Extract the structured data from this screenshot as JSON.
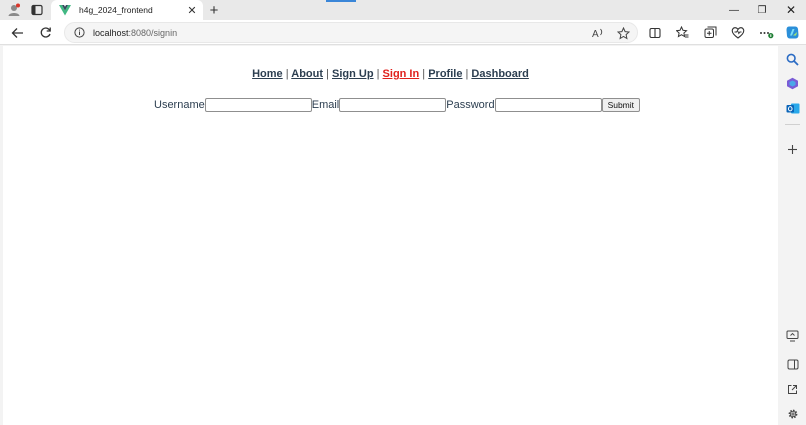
{
  "browser": {
    "tab": {
      "title": "h4g_2024_frontend",
      "close_glyph": "✕"
    },
    "new_tab_glyph": "+",
    "window": {
      "minimize": "—",
      "restore": "❐",
      "close": "✕"
    },
    "address": {
      "host": "localhost",
      "path": ":8080/signin"
    }
  },
  "page": {
    "nav": {
      "separator": "|",
      "items": [
        {
          "label": "Home",
          "active": false
        },
        {
          "label": "About",
          "active": false
        },
        {
          "label": "Sign Up",
          "active": false
        },
        {
          "label": "Sign In",
          "active": true
        },
        {
          "label": "Profile",
          "active": false
        },
        {
          "label": "Dashboard",
          "active": false
        }
      ]
    },
    "form": {
      "username_label": "Username",
      "username_value": "",
      "email_label": "Email",
      "email_value": "",
      "password_label": "Password",
      "password_value": "",
      "submit_label": "Submit"
    }
  },
  "colors": {
    "nav_text": "#2c3e50",
    "nav_active": "#e0201c",
    "vue_green": "#41b883",
    "vue_dark": "#35495e"
  }
}
